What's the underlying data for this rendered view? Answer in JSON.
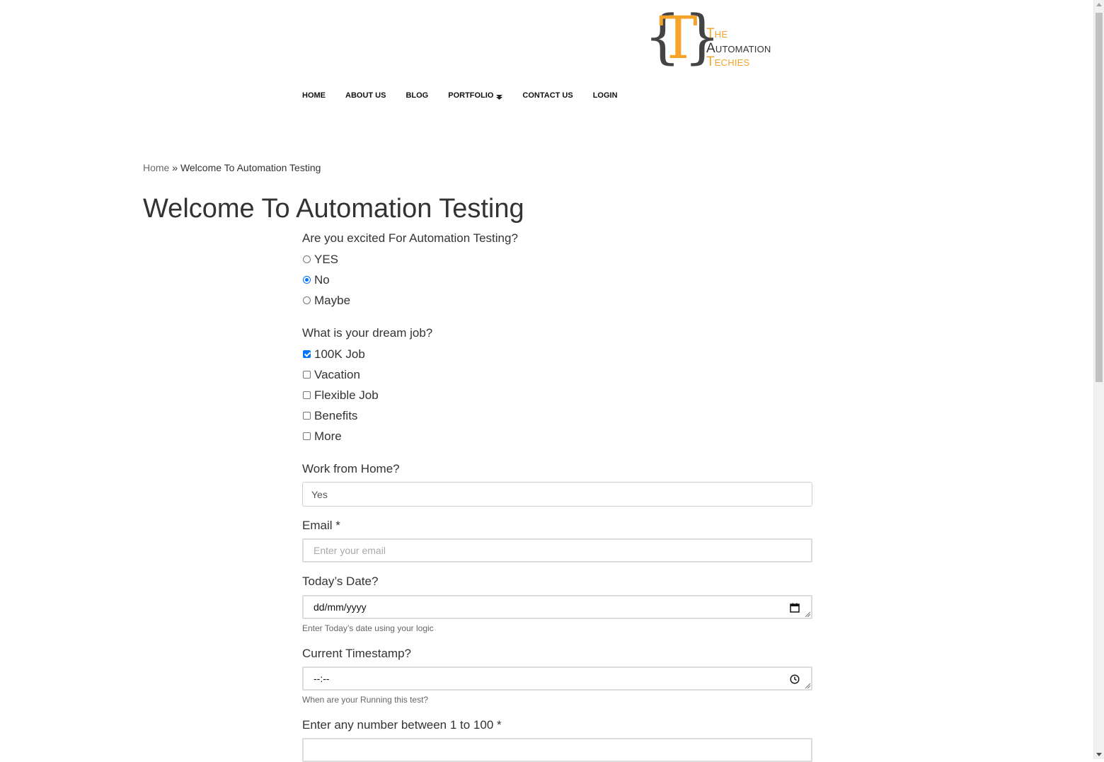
{
  "logo": {
    "brace_left": "{",
    "brace_right": "}",
    "letter": "T",
    "line1": "The",
    "line2": "Automation",
    "line3": "Techies"
  },
  "nav": {
    "items": [
      "HOME",
      "ABOUT US",
      "BLOG",
      "PORTFOLIO",
      "CONTACT US",
      "LOGIN"
    ]
  },
  "breadcrumb": {
    "home": "Home",
    "separator": "»",
    "current": "Welcome To Automation Testing"
  },
  "page_title": "Welcome To Automation Testing",
  "form": {
    "excited": {
      "label": "Are you excited For Automation Testing?",
      "options": [
        {
          "label": "YES",
          "selected": false
        },
        {
          "label": "No",
          "selected": true
        },
        {
          "label": "Maybe",
          "selected": false
        }
      ]
    },
    "dream_job": {
      "label": "What is your dream job?",
      "options": [
        {
          "label": "100K Job",
          "checked": true
        },
        {
          "label": "Vacation",
          "checked": false
        },
        {
          "label": "Flexible Job",
          "checked": false
        },
        {
          "label": "Benefits",
          "checked": false
        },
        {
          "label": "More",
          "checked": false
        }
      ]
    },
    "work_from_home": {
      "label": "Work from Home?",
      "value": "Yes"
    },
    "email": {
      "label": "Email *",
      "placeholder": "Enter your email"
    },
    "date": {
      "label": "Today’s Date?",
      "value": "dd/mm/yyyy",
      "hint": "Enter Today’s date using your logic"
    },
    "timestamp": {
      "label": "Current Timestamp?",
      "value": "--:--",
      "hint": "When are your Running this test?"
    },
    "number": {
      "label": "Enter any number between 1 to 100 *",
      "value": ""
    }
  },
  "colors": {
    "accent_orange": "#f5a32b",
    "control_blue": "#0075ff",
    "text": "#333333"
  },
  "icons": {
    "calendar": "calendar-icon",
    "clock": "clock-icon",
    "caret": "caret-down-icon"
  }
}
